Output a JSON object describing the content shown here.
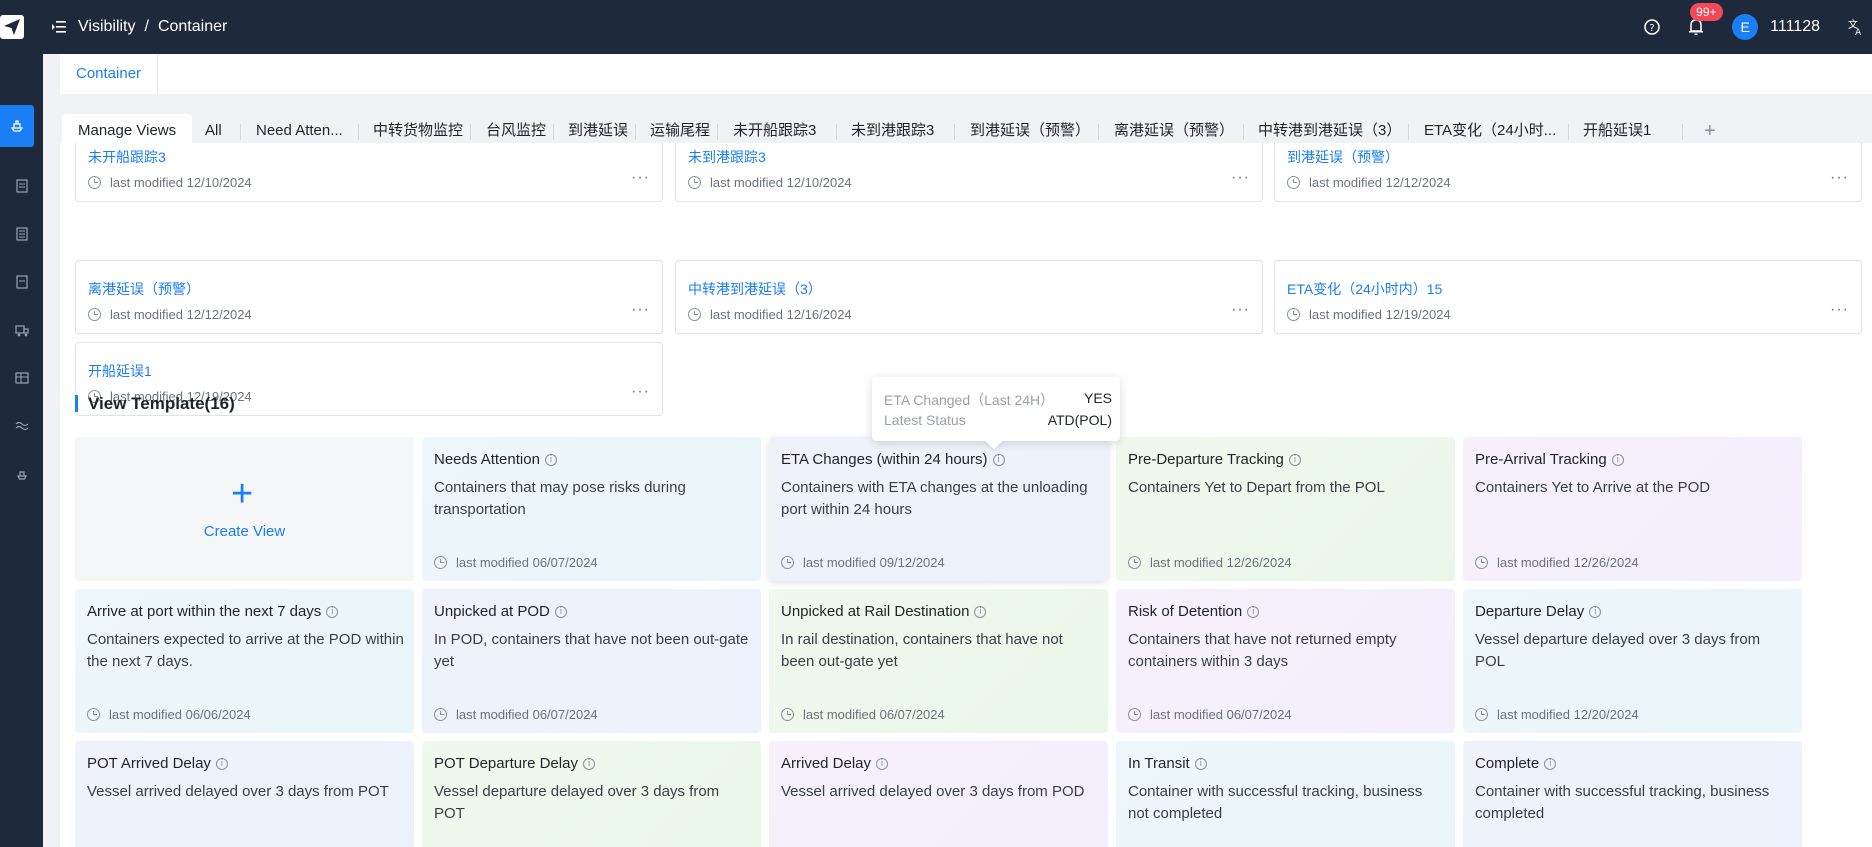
{
  "header": {
    "breadcrumb": [
      "Visibility",
      "Container"
    ],
    "breadcrumb_sep": "/",
    "notification_badge": "99+",
    "avatar_letter": "E",
    "user_id": "111128"
  },
  "page_tab": "Container",
  "view_tabs": [
    "Manage Views",
    "All",
    "Need Atten...",
    "中转货物监控",
    "台风监控",
    "到港延误",
    "运输尾程",
    "未开船跟踪3",
    "未到港跟踪3",
    "到港延误（预警）",
    "离港延误（预警）",
    "中转港到港延误（3）",
    "ETA变化（24小时...",
    "开船延误1"
  ],
  "my_views": [
    {
      "title": "未开船跟踪3",
      "modified": "last modified 12/10/2024"
    },
    {
      "title": "未到港跟踪3",
      "modified": "last modified 12/10/2024"
    },
    {
      "title": "到港延误（预警）",
      "modified": "last modified 12/12/2024"
    },
    {
      "title": "离港延误（预警）",
      "modified": "last modified 12/12/2024"
    },
    {
      "title": "中转港到港延误（3）",
      "modified": "last modified 12/16/2024"
    },
    {
      "title": "ETA变化（24小时内）15",
      "modified": "last modified 12/19/2024"
    },
    {
      "title": "开船延误1",
      "modified": "last modified 12/19/2024"
    }
  ],
  "more_label": "···",
  "section_title": "View Template(16)",
  "create_view": {
    "plus": "+",
    "label": "Create View"
  },
  "templates": [
    {
      "title": "Needs Attention",
      "desc": "Containers that may pose risks during transportation",
      "modified": "last modified 06/07/2024"
    },
    {
      "title": "ETA Changes (within 24 hours)",
      "desc": "Containers with ETA changes at the unloading port within 24 hours",
      "modified": "last modified 09/12/2024"
    },
    {
      "title": "Pre-Departure Tracking",
      "desc": "Containers Yet to Depart from the POL",
      "modified": "last modified 12/26/2024"
    },
    {
      "title": "Pre-Arrival Tracking",
      "desc": "Containers Yet to Arrive at the POD",
      "modified": "last modified 12/26/2024"
    },
    {
      "title": "Arrive at port within the next 7 days",
      "desc": "Containers expected to arrive at the POD within the next 7 days.",
      "modified": "last modified 06/06/2024"
    },
    {
      "title": "Unpicked at POD",
      "desc": "In POD, containers that have not been out-gate yet",
      "modified": "last modified 06/07/2024"
    },
    {
      "title": "Unpicked at Rail Destination",
      "desc": "In rail destination, containers that have not been out-gate yet",
      "modified": "last modified 06/07/2024"
    },
    {
      "title": "Risk of Detention",
      "desc": "Containers that have not returned empty containers within 3 days",
      "modified": "last modified 06/07/2024"
    },
    {
      "title": "Departure Delay",
      "desc": "Vessel departure delayed over 3 days from POL",
      "modified": "last modified 12/20/2024"
    },
    {
      "title": "POT Arrived Delay",
      "desc": "Vessel arrived delayed over 3 days from POT",
      "modified": ""
    },
    {
      "title": "POT Departure Delay",
      "desc": "Vessel departure delayed over 3 days from POT",
      "modified": ""
    },
    {
      "title": "Arrived Delay",
      "desc": "Vessel arrived delayed over 3 days from POD",
      "modified": ""
    },
    {
      "title": "In Transit",
      "desc": "Container with successful tracking, business not completed",
      "modified": ""
    },
    {
      "title": "Complete",
      "desc": "Container with successful tracking, business completed",
      "modified": ""
    }
  ],
  "tooltip": {
    "rows": [
      {
        "key": "ETA Changed（Last 24H）",
        "value": "YES"
      },
      {
        "key": "Latest Status",
        "value": "ATD(POL)"
      }
    ]
  }
}
